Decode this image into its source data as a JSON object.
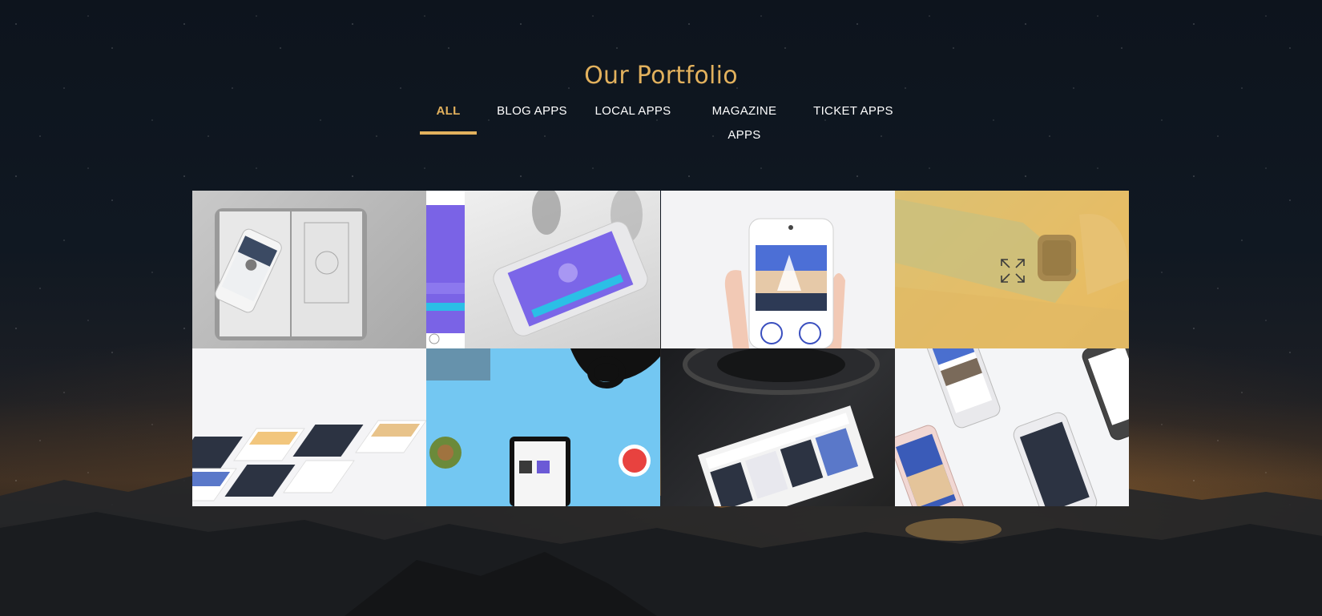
{
  "section": {
    "title": "Our Portfolio"
  },
  "filters": [
    {
      "label": "ALL",
      "active": true
    },
    {
      "label": "BLOG APPS",
      "active": false
    },
    {
      "label": "LOCAL  APPS",
      "active": false
    },
    {
      "label": "MAGAZINE  APPS",
      "active": false
    },
    {
      "label": "TICKET  APPS",
      "active": false
    }
  ],
  "colors": {
    "accent": "#e2b15d",
    "tab_text": "#ffffff"
  },
  "portfolio": {
    "items": [
      {
        "image": "phone-on-sketchbook"
      },
      {
        "image": "phone-app-purple"
      },
      {
        "image": "hand-holding-phone"
      },
      {
        "image": "smartwatch-on-wrist",
        "hovered": true,
        "icon": "expand-icon"
      },
      {
        "image": "app-screens-isometric"
      },
      {
        "image": "tablet-on-blue-desk"
      },
      {
        "image": "tablet-with-camera-lens"
      },
      {
        "image": "phones-on-white"
      }
    ]
  }
}
